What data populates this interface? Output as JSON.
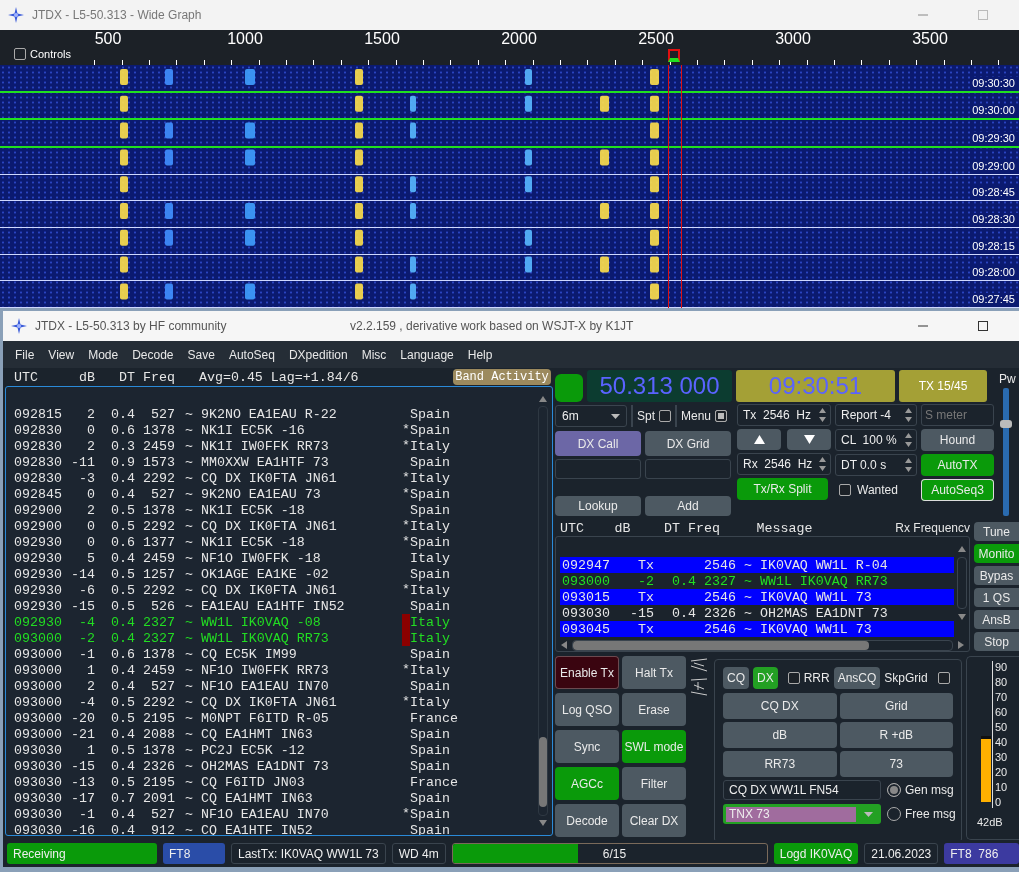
{
  "wide_graph": {
    "title": "JTDX - L5-50.313 - Wide Graph",
    "controls": {
      "label": "Controls",
      "checked": false
    },
    "scale_labels": [
      "500",
      "1000",
      "1500",
      "2000",
      "2500",
      "3000",
      "3500"
    ],
    "times": [
      "09:30:30",
      "09:30:00",
      "09:29:30",
      "09:29:00",
      "09:28:45",
      "09:28:30",
      "09:28:15",
      "09:28:00",
      "09:27:45"
    ]
  },
  "main_window": {
    "title": "JTDX - L5-50.313  by HF community",
    "version": "v2.2.159 , derivative work based on WSJT-X by K1JT"
  },
  "menu": [
    "File",
    "View",
    "Mode",
    "Decode",
    "Save",
    "AutoSeq",
    "DXpedition",
    "Misc",
    "Language",
    "Help"
  ],
  "band_activity": {
    "columns": {
      "utc": "UTC",
      "db": "dB",
      "dt": "DT",
      "freq": "Freq",
      "stats": "Avg=0.45 Lag=+1.84/6"
    },
    "button": "Band Activity",
    "rows": [
      {
        "utc": "092815",
        "db": "2",
        "dt": "0.4",
        "freq": "527",
        "message": "~ 9K2NO EA1EAU R-22",
        "country": "Spain",
        "highlighted": false,
        "marked": false
      },
      {
        "utc": "092830",
        "db": "0",
        "dt": "0.6",
        "freq": "1378",
        "message": "~ NK1I EC5K -16",
        "flag": "*",
        "country": "Spain",
        "highlighted": false,
        "marked": false
      },
      {
        "utc": "092830",
        "db": "2",
        "dt": "0.3",
        "freq": "2459",
        "message": "~ NK1I IW0FFK RR73",
        "flag": "*",
        "country": "Italy",
        "highlighted": false,
        "marked": false
      },
      {
        "utc": "092830",
        "db": "-11",
        "dt": "0.9",
        "freq": "1573",
        "message": "~ MM0XXW EA1HTF 73",
        "country": "Spain",
        "highlighted": false,
        "marked": false
      },
      {
        "utc": "092830",
        "db": "-3",
        "dt": "0.4",
        "freq": "2292",
        "message": "~ CQ DX IK0FTA JN61",
        "flag": "*",
        "country": "Italy",
        "highlighted": false,
        "marked": false
      },
      {
        "utc": "092845",
        "db": "0",
        "dt": "0.4",
        "freq": "527",
        "message": "~ 9K2NO EA1EAU 73",
        "flag": "*",
        "country": "Spain",
        "highlighted": false,
        "marked": false
      },
      {
        "utc": "092900",
        "db": "2",
        "dt": "0.5",
        "freq": "1378",
        "message": "~ NK1I EC5K -18",
        "country": "Spain",
        "highlighted": false,
        "marked": false
      },
      {
        "utc": "092900",
        "db": "0",
        "dt": "0.5",
        "freq": "2292",
        "message": "~ CQ DX IK0FTA JN61",
        "flag": "*",
        "country": "Italy",
        "highlighted": false,
        "marked": false
      },
      {
        "utc": "092930",
        "db": "0",
        "dt": "0.6",
        "freq": "1377",
        "message": "~ NK1I EC5K -18",
        "flag": "*",
        "country": "Spain",
        "highlighted": false,
        "marked": false
      },
      {
        "utc": "092930",
        "db": "5",
        "dt": "0.4",
        "freq": "2459",
        "message": "~ NF1O IW0FFK -18",
        "country": "Italy",
        "highlighted": false,
        "marked": false
      },
      {
        "utc": "092930",
        "db": "-14",
        "dt": "0.5",
        "freq": "1257",
        "message": "~ OK1AGE EA1KE -02",
        "country": "Spain",
        "highlighted": false,
        "marked": false
      },
      {
        "utc": "092930",
        "db": "-6",
        "dt": "0.5",
        "freq": "2292",
        "message": "~ CQ DX IK0FTA JN61",
        "flag": "*",
        "country": "Italy",
        "highlighted": false,
        "marked": false
      },
      {
        "utc": "092930",
        "db": "-15",
        "dt": "0.5",
        "freq": "526",
        "message": "~ EA1EAU EA1HTF IN52",
        "country": "Spain",
        "highlighted": false,
        "marked": false
      },
      {
        "utc": "092930",
        "db": "-4",
        "dt": "0.4",
        "freq": "2327",
        "message": "~ WW1L IK0VAQ -08",
        "country": "Italy",
        "highlighted": true,
        "marked": true
      },
      {
        "utc": "093000",
        "db": "-2",
        "dt": "0.4",
        "freq": "2327",
        "message": "~ WW1L IK0VAQ RR73",
        "country": "Italy",
        "highlighted": true,
        "marked": true
      },
      {
        "utc": "093000",
        "db": "-1",
        "dt": "0.6",
        "freq": "1378",
        "message": "~ CQ EC5K IM99",
        "country": "Spain",
        "highlighted": false,
        "marked": false
      },
      {
        "utc": "093000",
        "db": "1",
        "dt": "0.4",
        "freq": "2459",
        "message": "~ NF1O IW0FFK RR73",
        "flag": "*",
        "country": "Italy",
        "highlighted": false,
        "marked": false
      },
      {
        "utc": "093000",
        "db": "2",
        "dt": "0.4",
        "freq": "527",
        "message": "~ NF1O EA1EAU IN70",
        "country": "Spain",
        "highlighted": false,
        "marked": false
      },
      {
        "utc": "093000",
        "db": "-4",
        "dt": "0.5",
        "freq": "2292",
        "message": "~ CQ DX IK0FTA JN61",
        "flag": "*",
        "country": "Italy",
        "highlighted": false,
        "marked": false
      },
      {
        "utc": "093000",
        "db": "-20",
        "dt": "0.5",
        "freq": "2195",
        "message": "~ M0NPT F6ITD R-05",
        "country": "France",
        "highlighted": false,
        "marked": false
      },
      {
        "utc": "093000",
        "db": "-21",
        "dt": "0.4",
        "freq": "2088",
        "message": "~ CQ EA1HMT IN63",
        "country": "Spain",
        "highlighted": false,
        "marked": false
      },
      {
        "utc": "093030",
        "db": "1",
        "dt": "0.5",
        "freq": "1378",
        "message": "~ PC2J EC5K -12",
        "country": "Spain",
        "highlighted": false,
        "marked": false
      },
      {
        "utc": "093030",
        "db": "-15",
        "dt": "0.4",
        "freq": "2326",
        "message": "~ OH2MAS EA1DNT 73",
        "country": "Spain",
        "highlighted": false,
        "marked": false
      },
      {
        "utc": "093030",
        "db": "-13",
        "dt": "0.5",
        "freq": "2195",
        "message": "~ CQ F6ITD JN03",
        "country": "France",
        "highlighted": false,
        "marked": false
      },
      {
        "utc": "093030",
        "db": "-17",
        "dt": "0.7",
        "freq": "2091",
        "message": "~ CQ EA1HMT IN63",
        "country": "Spain",
        "highlighted": false,
        "marked": false
      },
      {
        "utc": "093030",
        "db": "-1",
        "dt": "0.4",
        "freq": "527",
        "message": "~ NF1O EA1EAU IN70",
        "flag": "*",
        "country": "Spain",
        "highlighted": false,
        "marked": false
      },
      {
        "utc": "093030",
        "db": "-16",
        "dt": "0.4",
        "freq": "912",
        "message": "~ CQ EA1HTF IN52",
        "country": "Spain",
        "highlighted": false,
        "marked": false
      }
    ]
  },
  "top_bar": {
    "led_on": true,
    "frequency": "50.313 000",
    "time": "09:30:51",
    "tx_period": "TX 15/45",
    "power": {
      "label": "Pw",
      "level": 0.72
    }
  },
  "controls": {
    "band": "6m",
    "checks": [
      {
        "label": "Spt",
        "checked": false
      },
      {
        "label": "Menu",
        "checked": true
      }
    ],
    "dx_buttons": [
      {
        "label": "DX Call",
        "focused": true
      },
      {
        "label": "DX Grid",
        "focused": false
      }
    ],
    "lookup_buttons": [
      "Lookup",
      "Add"
    ],
    "tx_freq": "Tx  2546  Hz",
    "rx_freq": "Rx  2546  Hz",
    "tx_rx_split": {
      "label": "Tx/Rx Split",
      "on": true
    },
    "report": "Report -4",
    "cl": "CL  100 %",
    "dt": "DT 0.0 s",
    "wanted": {
      "label": "Wanted",
      "checked": false
    },
    "s_meter": {
      "placeholder": "S meter"
    },
    "hound": {
      "label": "Hound",
      "on": false
    },
    "auto_tx": {
      "label": "AutoTX",
      "on": true
    },
    "auto_seq": {
      "label": "AutoSeq3",
      "on": true
    }
  },
  "rx_frequency": {
    "columns": [
      "UTC",
      "dB",
      "DT",
      "Freq",
      "Message"
    ],
    "title": "Rx Frequencv",
    "rows": [
      {
        "kind": "tx",
        "utc": "092947",
        "db": "Tx",
        "freq": "2546",
        "message": "~ IK0VAQ WW1L R-04"
      },
      {
        "kind": "mine",
        "utc": "093000",
        "db": "-2",
        "dt": "0.4",
        "freq": "2327",
        "message": "~ WW1L IK0VAQ RR73"
      },
      {
        "kind": "tx",
        "utc": "093015",
        "db": "Tx",
        "freq": "2546",
        "message": "~ IK0VAQ WW1L 73"
      },
      {
        "kind": "normal",
        "utc": "093030",
        "db": "-15",
        "dt": "0.4",
        "freq": "2326",
        "message": "~ OH2MAS EA1DNT 73"
      },
      {
        "kind": "tx",
        "utc": "093045",
        "db": "Tx",
        "freq": "2546",
        "message": "~ IK0VAQ WW1L 73"
      }
    ],
    "side_buttons": [
      {
        "label": "Tune",
        "on": false
      },
      {
        "label": "Monito",
        "on": true
      },
      {
        "label": "Bypas",
        "on": false
      },
      {
        "label": "1 QS",
        "on": false
      },
      {
        "label": "AnsB",
        "on": false
      },
      {
        "label": "Stop",
        "on": false
      }
    ]
  },
  "action_buttons": [
    {
      "label": "Enable Tx",
      "kind": "tx",
      "on": false
    },
    {
      "label": "Halt Tx",
      "kind": "push",
      "on": false
    },
    {
      "label": "Log QSO",
      "kind": "push",
      "on": false
    },
    {
      "label": "Erase",
      "kind": "push",
      "on": false
    },
    {
      "label": "Sync",
      "kind": "push",
      "on": false
    },
    {
      "label": "SWL mode",
      "kind": "push",
      "on": true
    },
    {
      "label": "AGCc",
      "kind": "push",
      "on": true
    },
    {
      "label": "Filter",
      "kind": "push",
      "on": false
    },
    {
      "label": "Decode",
      "kind": "push",
      "on": false
    },
    {
      "label": "Clear DX",
      "kind": "push",
      "on": false
    }
  ],
  "messages": {
    "mode_buttons": [
      {
        "label": "CQ",
        "selected": false
      },
      {
        "label": "DX",
        "selected": true
      }
    ],
    "rrr": {
      "label": "RRR",
      "checked": false
    },
    "ans_cq": "AnsCQ",
    "skip_grid": {
      "label": "SkpGrid",
      "checked": false
    },
    "buttons": [
      "CQ DX",
      "Grid",
      "dB",
      "R +dB",
      "RR73",
      "73"
    ],
    "generated": "CQ DX WW1L FN54",
    "free": "TNX 73",
    "radios": [
      {
        "label": "Gen msg",
        "selected": true
      },
      {
        "label": "Free msg",
        "selected": false
      }
    ]
  },
  "meter": {
    "ticks": [
      "90",
      "80",
      "70",
      "60",
      "50",
      "40",
      "30",
      "20",
      "10",
      "0"
    ],
    "level": 0.47,
    "reading": "42dB"
  },
  "status_bar": [
    {
      "kind": "label",
      "text": "Receiving",
      "color": "#0a9a0a"
    },
    {
      "kind": "label",
      "text": "FT8",
      "color": "#2a4da8"
    },
    {
      "kind": "plain",
      "text": "LastTx: IK0VAQ WW1L 73"
    },
    {
      "kind": "plain",
      "text": "WD 4m"
    },
    {
      "kind": "progress",
      "text": "6/15",
      "level": 0.4
    },
    {
      "kind": "label",
      "text": "Logd IK0VAQ",
      "color": "#0a9a0a"
    },
    {
      "kind": "plain",
      "text": "21.06.2023"
    },
    {
      "kind": "label",
      "text": "FT8  786",
      "color": "#3c3aa0"
    }
  ]
}
